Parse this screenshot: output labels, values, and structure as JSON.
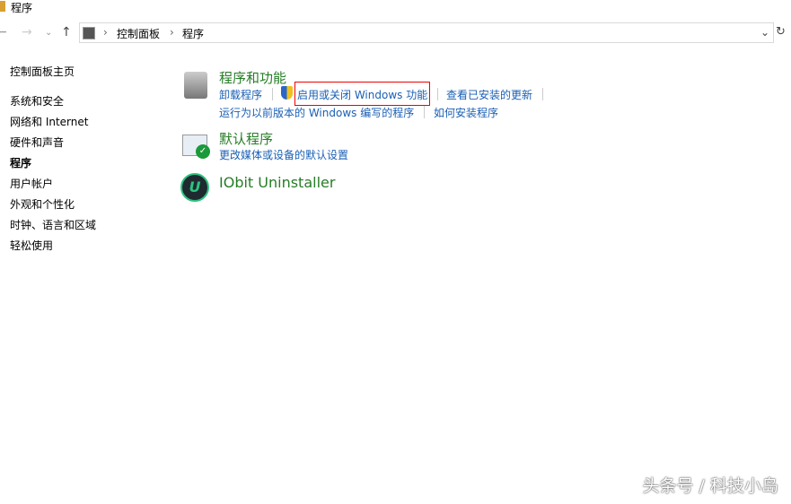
{
  "window": {
    "title": "程序"
  },
  "address": {
    "crumbs": [
      "控制面板",
      "程序"
    ]
  },
  "sidebar": {
    "items": [
      "控制面板主页",
      "系统和安全",
      "网络和 Internet",
      "硬件和声音",
      "程序",
      "用户帐户",
      "外观和个性化",
      "时钟、语言和区域",
      "轻松使用"
    ]
  },
  "sections": [
    {
      "title": "程序和功能",
      "links": [
        "卸载程序",
        "启用或关闭 Windows 功能",
        "查看已安装的更新",
        "运行为以前版本的 Windows 编写的程序",
        "如何安装程序"
      ]
    },
    {
      "title": "默认程序",
      "links": [
        "更改媒体或设备的默认设置"
      ]
    },
    {
      "title": "IObit Uninstaller",
      "links": []
    }
  ],
  "watermark": "头条号 / 科技小岛"
}
